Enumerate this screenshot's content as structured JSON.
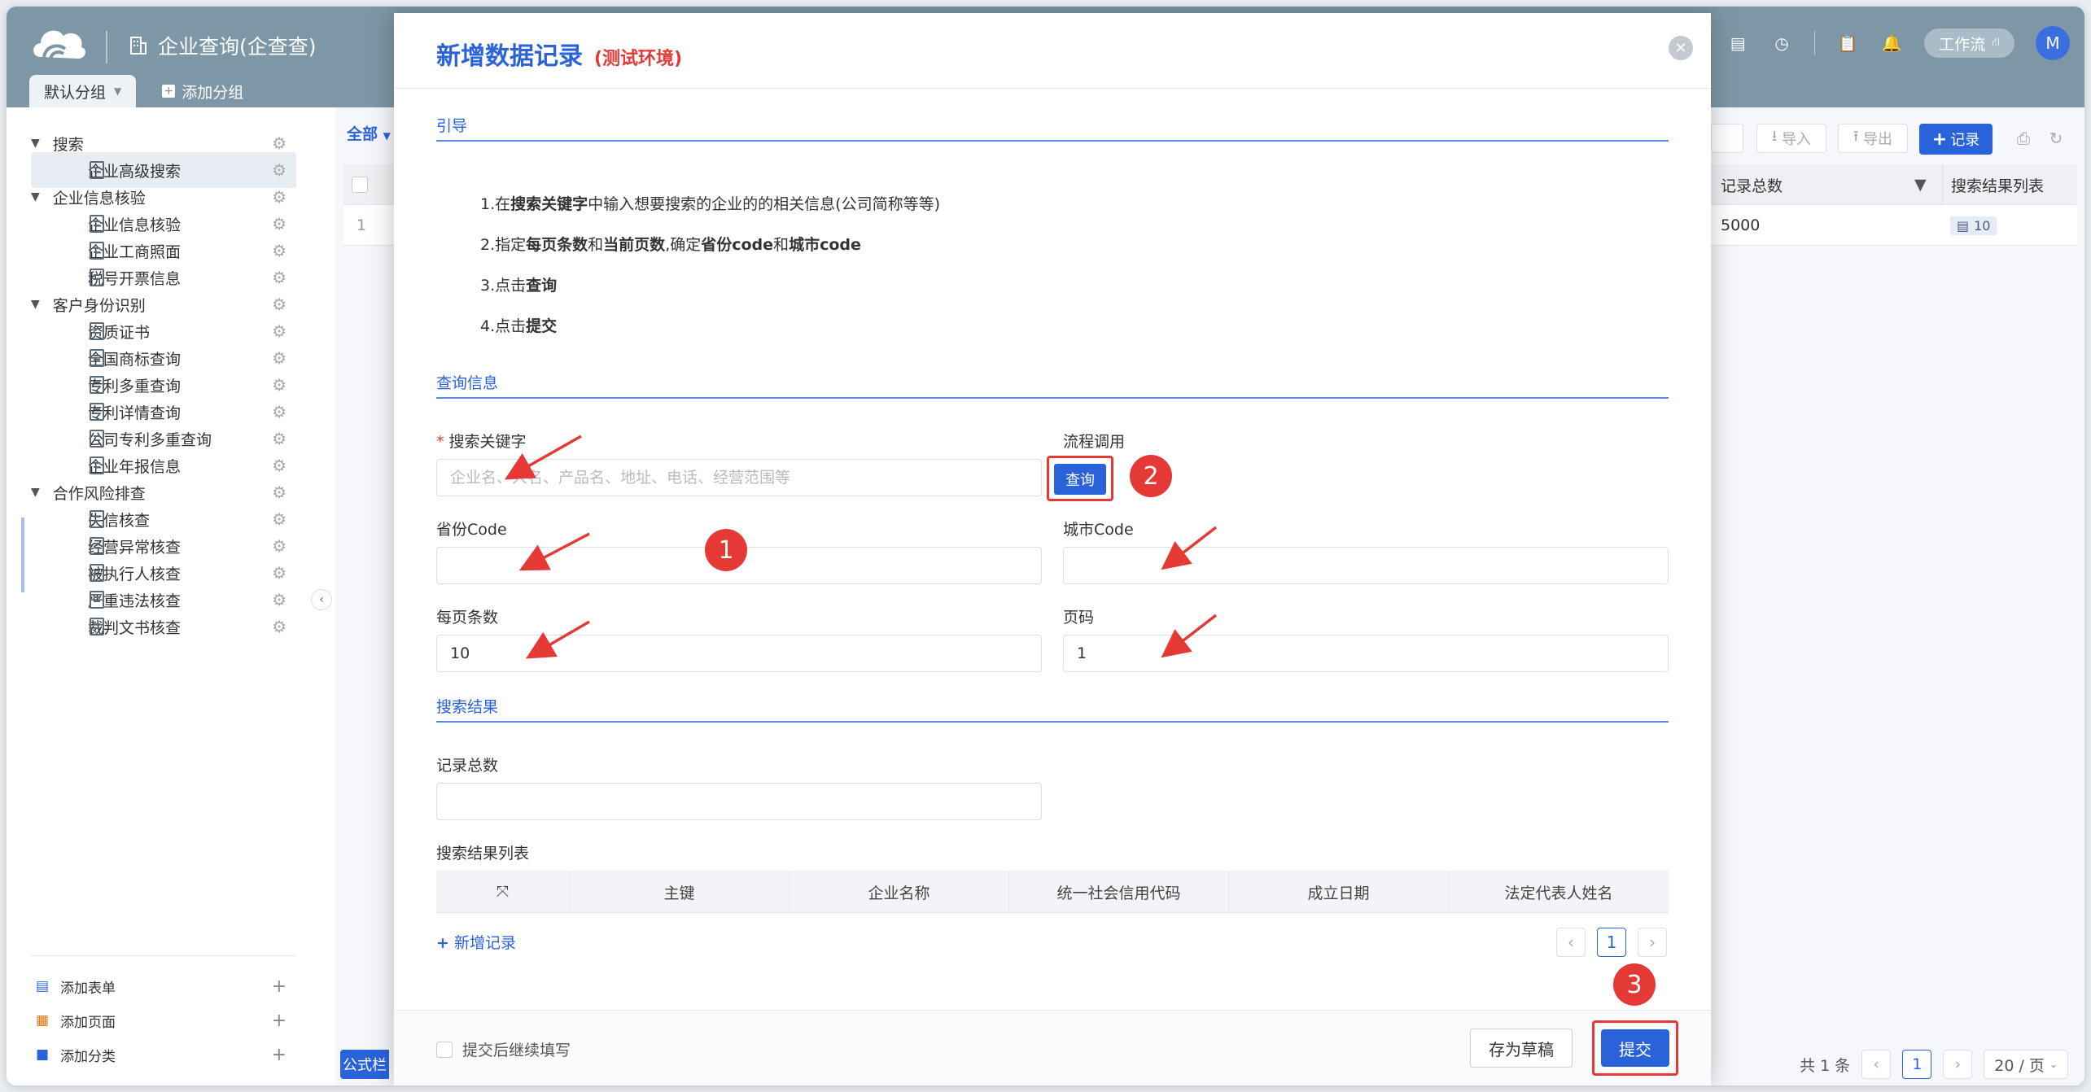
{
  "app": {
    "title": "企业查询(企查查)"
  },
  "tabs": [
    {
      "label": "默认分组"
    },
    {
      "label": "添加分组"
    }
  ],
  "topbar": {
    "workflow_label": "工作流",
    "avatar": "M"
  },
  "sidebar": {
    "groups": [
      {
        "label": "搜索",
        "items": [
          {
            "label": "企业高级搜索"
          }
        ]
      },
      {
        "label": "企业信息核验",
        "items": [
          {
            "label": "企业信息核验"
          },
          {
            "label": "企业工商照面"
          },
          {
            "label": "税号开票信息"
          }
        ]
      },
      {
        "label": "客户身份识别",
        "items": [
          {
            "label": "资质证书"
          },
          {
            "label": "全国商标查询"
          },
          {
            "label": "专利多重查询"
          },
          {
            "label": "专利详情查询"
          },
          {
            "label": "公司专利多重查询"
          },
          {
            "label": "企业年报信息"
          }
        ]
      },
      {
        "label": "合作风险排查",
        "items": [
          {
            "label": "失信核查"
          },
          {
            "label": "经营异常核查"
          },
          {
            "label": "被执行人核查"
          },
          {
            "label": "严重违法核查"
          },
          {
            "label": "裁判文书核查"
          }
        ]
      }
    ],
    "add_form": "添加表单",
    "add_page": "添加页面",
    "add_category": "添加分类"
  },
  "main": {
    "filter_all": "全部",
    "import_label": "导入",
    "export_label": "导出",
    "record_label": "记录",
    "columns": [
      "记录总数",
      "搜索结果列表"
    ],
    "rows": [
      {
        "index": "1",
        "total": "5000",
        "result_count": "10"
      }
    ],
    "formula_label": "公式栏",
    "pagination": {
      "total": "共 1 条",
      "page": "1",
      "page_size": "20 / 页"
    }
  },
  "modal": {
    "title": "新增数据记录",
    "env": "(测试环境)",
    "sections": {
      "guide": "引导",
      "query": "查询信息",
      "result": "搜索结果"
    },
    "guide": {
      "l1_a": "1.在",
      "l1_b": "搜索关键字",
      "l1_c": "中输入想要搜索的企业的的相关信息(公司简称等等)",
      "l2_a": "2.指定",
      "l2_b": "每页条数",
      "l2_c": "和",
      "l2_d": "当前页数",
      "l2_e": ",确定",
      "l2_f": "省份code",
      "l2_g": "和",
      "l2_h": "城市code",
      "l3_a": "3.点击",
      "l3_b": "查询",
      "l4_a": "4.点击",
      "l4_b": "提交"
    },
    "fields": {
      "keyword_label": "搜索关键字",
      "keyword_placeholder": "企业名、人名、产品名、地址、电话、经营范围等",
      "flow_label": "流程调用",
      "query_btn": "查询",
      "province_label": "省份Code",
      "province_value": "",
      "city_label": "城市Code",
      "city_value": "",
      "page_size_label": "每页条数",
      "page_size_value": "10",
      "page_label": "页码",
      "page_value": "1",
      "total_label": "记录总数",
      "total_value": "",
      "result_list_label": "搜索结果列表"
    },
    "subtable_columns": [
      "主键",
      "企业名称",
      "统一社会信用代码",
      "成立日期",
      "法定代表人姓名"
    ],
    "add_record": "新增记录",
    "pager_page": "1",
    "footer": {
      "continue_label": "提交后继续填写",
      "draft": "存为草稿",
      "submit": "提交"
    },
    "badges": [
      "1",
      "2",
      "3"
    ]
  },
  "colors": {
    "primary": "#2a63d9",
    "annotation": "#e53935",
    "topbar": "#7d97a6"
  }
}
